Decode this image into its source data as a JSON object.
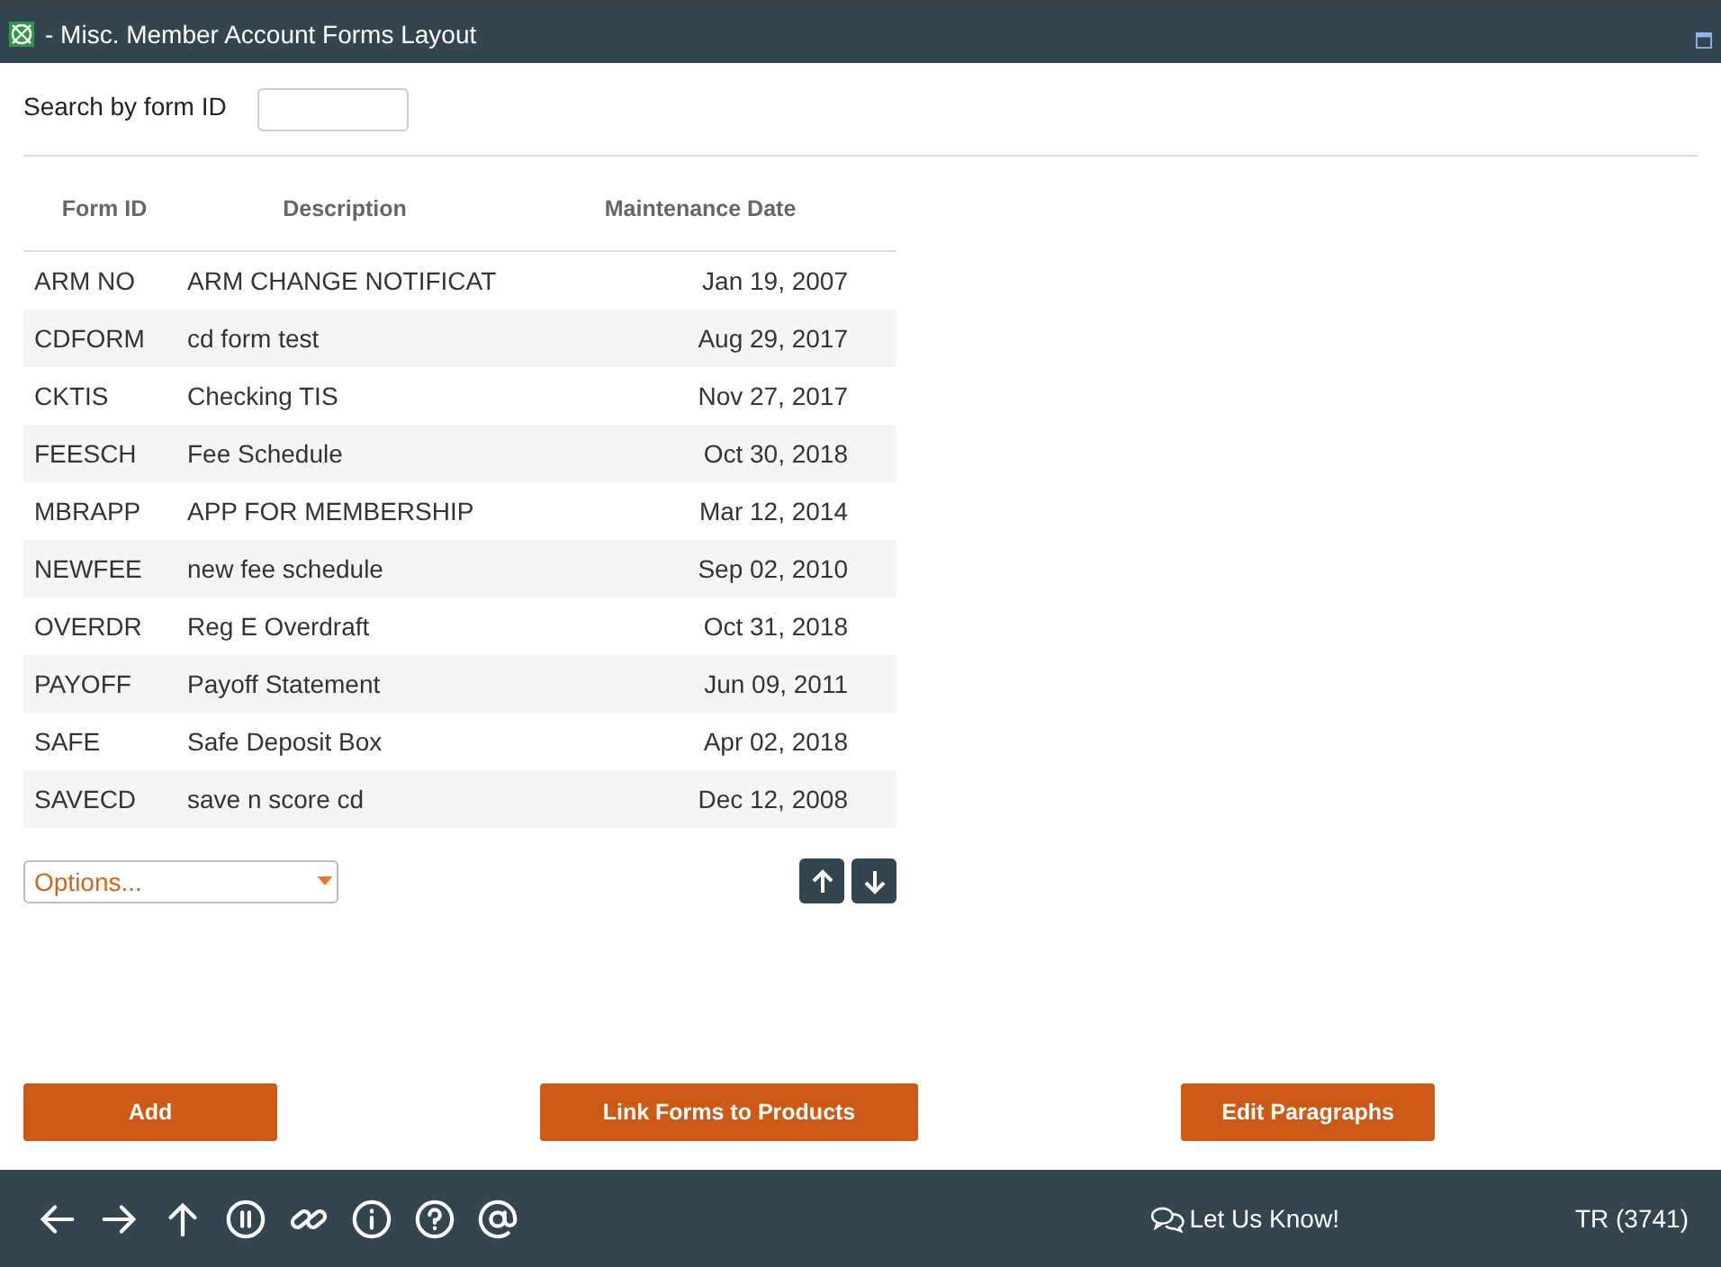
{
  "window": {
    "title": "- Misc. Member Account Forms Layout"
  },
  "search": {
    "label": "Search by form ID"
  },
  "table": {
    "columns": [
      "Form ID",
      "Description",
      "Maintenance Date"
    ],
    "rows": [
      {
        "form_id": "ARM NO",
        "description": "ARM CHANGE NOTIFICAT",
        "date": "Jan 19, 2007"
      },
      {
        "form_id": "CDFORM",
        "description": "cd form test",
        "date": "Aug 29, 2017"
      },
      {
        "form_id": "CKTIS",
        "description": "Checking TIS",
        "date": "Nov 27, 2017"
      },
      {
        "form_id": "FEESCH",
        "description": "Fee Schedule",
        "date": "Oct 30, 2018"
      },
      {
        "form_id": "MBRAPP",
        "description": "APP FOR MEMBERSHIP",
        "date": "Mar 12, 2014"
      },
      {
        "form_id": "NEWFEE",
        "description": "new fee schedule",
        "date": "Sep 02, 2010"
      },
      {
        "form_id": "OVERDR",
        "description": "Reg E Overdraft",
        "date": "Oct 31, 2018"
      },
      {
        "form_id": "PAYOFF",
        "description": "Payoff Statement",
        "date": "Jun 09, 2011"
      },
      {
        "form_id": "SAFE",
        "description": "Safe Deposit Box",
        "date": "Apr 02, 2018"
      },
      {
        "form_id": "SAVECD",
        "description": "save n score cd",
        "date": "Dec 12, 2008"
      }
    ]
  },
  "options": {
    "placeholder": "Options..."
  },
  "buttons": [
    "Add",
    "Link Forms to Products",
    "Edit Paragraphs"
  ],
  "footer": {
    "feedback": "Let Us Know!",
    "user": "TR (3741)"
  }
}
